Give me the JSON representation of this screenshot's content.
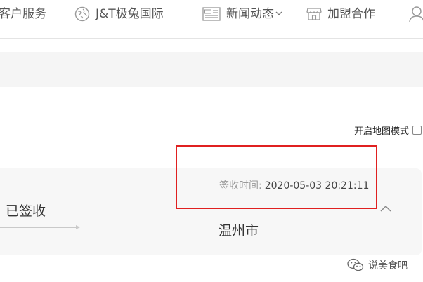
{
  "nav": {
    "items": [
      {
        "label": "客户服务",
        "icon": "service-icon"
      },
      {
        "label": "J&T极兔国际",
        "icon": "globe-icon"
      },
      {
        "label": "新闻动态",
        "icon": "news-icon",
        "has_dropdown": true
      },
      {
        "label": "加盟合作",
        "icon": "store-icon"
      },
      {
        "label": "",
        "icon": "user-icon"
      }
    ]
  },
  "map_mode": {
    "label": "开启地图模式",
    "checked": false
  },
  "tracking": {
    "status": "已签收",
    "sign_time_label": "签收时间:",
    "sign_time_value": "2020-05-03 20:21:11",
    "city": "温州市"
  },
  "watermark": {
    "text": "说美食吧",
    "icon": "wechat-icon"
  },
  "colors": {
    "highlight": "#e02020",
    "card_bg": "#f7f7f7",
    "bar_bg": "#f5f5f5"
  }
}
